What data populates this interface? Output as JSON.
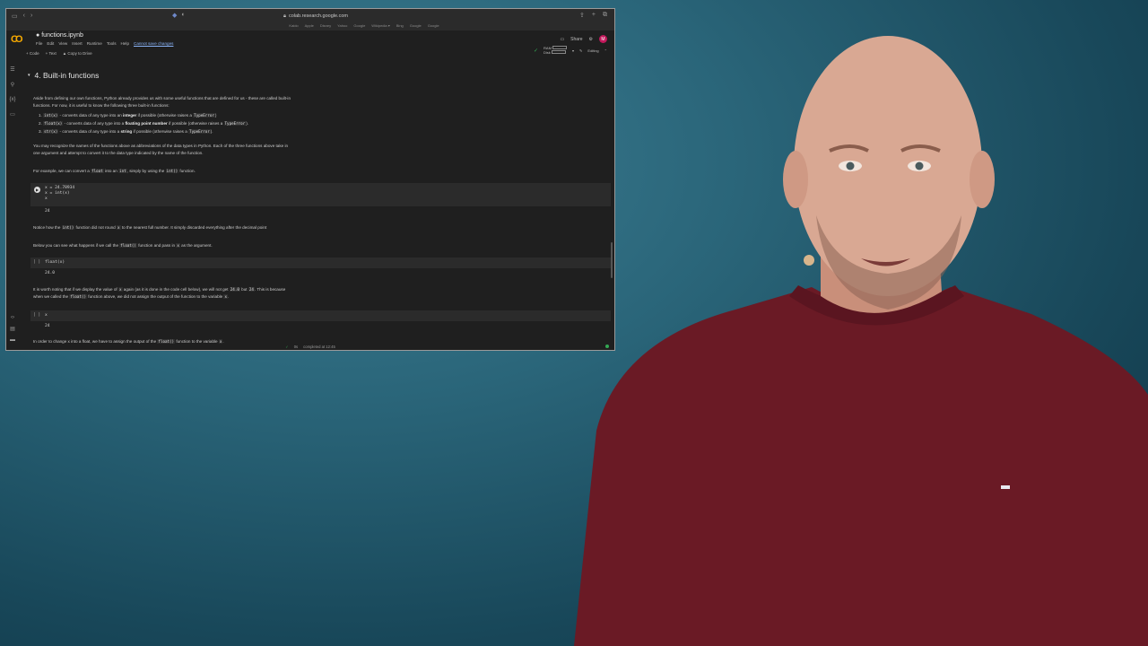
{
  "browser": {
    "url": "colab.research.google.com",
    "bookmarks": [
      "Kaido",
      "Apple",
      "Disney",
      "Yahoo",
      "Google",
      "Wikipedia ▾",
      "Bing",
      "Google",
      "Google"
    ]
  },
  "colab": {
    "logo": "CO",
    "notebook_title": "functions.ipynb",
    "menu": [
      "File",
      "Edit",
      "View",
      "Insert",
      "Runtime",
      "Tools",
      "Help"
    ],
    "unsaved": "Cannot save changes",
    "share": "Share",
    "avatar": "M",
    "toolbar": {
      "code": "+ Code",
      "text": "+ Text",
      "copy": "Copy to Drive"
    },
    "ram_label": "RAM",
    "disk_label": "Disk",
    "editing": "Editing"
  },
  "section": {
    "title": "4. Built-in functions"
  },
  "paragraphs": {
    "intro_1": "Aside from defining our own functions, Python already provides us with some useful functions that are defined for us - these are called built-in",
    "intro_2": "functions. For now, it is useful to know the following three built-in functions:",
    "list": [
      {
        "num": "1.",
        "code": "int(x)",
        "text_a": " - converts data of any type into an ",
        "bold": "integer",
        "text_b": " if possible (otherwise raises a ",
        "err": "TypeError",
        "end": ")"
      },
      {
        "num": "2.",
        "code": "float(x)",
        "text_a": " - converts data of any type into a ",
        "bold": "floating point number",
        "text_b": " if possible (otherwise raises a ",
        "err": "TypeError",
        "end": ")."
      },
      {
        "num": "3.",
        "code": "str(x)",
        "text_a": " - converts data of any type into a ",
        "bold": "string",
        "text_b": " if possible (otherwise raises a ",
        "err": "TypeError",
        "end": ")."
      }
    ],
    "recognize_1": "You may recognize the names of the functions above as abbreviations of the data types in Python. Each of the three functions above take in",
    "recognize_2": "one argument and attempt to convert it to the data type indicated by the name of the function.",
    "example_a": "For example, we can convert a ",
    "example_code1": "float",
    "example_b": " into an ",
    "example_code2": "int",
    "example_c": ", simply by using the ",
    "example_code3": "int()",
    "example_d": " function.",
    "notice_a": "Notice how the ",
    "notice_code1": "int()",
    "notice_b": " function did not round ",
    "notice_code2": "x",
    "notice_c": " to the nearest full number. It simply discarded everything after the decimal point",
    "below_a": "Below you can see what happens if we call the ",
    "below_code1": "float()",
    "below_b": " function and pass in ",
    "below_code2": "x",
    "below_c": " as the argument.",
    "worth_a": "It is worth noting that if we display the value of ",
    "worth_code1": "x",
    "worth_b": " again (as it is done in the code cell below), we will not get ",
    "worth_code2": "24.0",
    "worth_c": " but ",
    "worth_code3": "24",
    "worth_d": ". This is because",
    "worth2_a": "when we called the ",
    "worth2_code1": "float()",
    "worth2_b": " function above, we did not assign the output of the function to the variable ",
    "worth2_code2": "x",
    "worth2_c": ".",
    "change_a": "In order to change x into a float, we have to assign the output of the ",
    "change_code1": "float()",
    "change_b": " function to the variable ",
    "change_code2": "x",
    "change_c": "."
  },
  "cells": {
    "c1_line1": "x = 24.78934",
    "c1_line2": "x = int(x)",
    "c1_line3": "x",
    "c1_out": "24",
    "c2_idle": "[ ]",
    "c2_line1": "float(x)",
    "c2_out": "24.0",
    "c3_idle": "[ ]",
    "c3_line1": "x",
    "c3_out": "24"
  },
  "status": {
    "check": "✓",
    "time": "0s",
    "completed": "completed at 12:45"
  }
}
